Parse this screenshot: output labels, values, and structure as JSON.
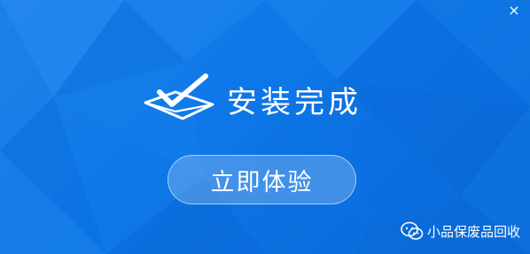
{
  "window": {
    "close_glyph": "×",
    "background_color": "#0f78e8"
  },
  "hero": {
    "icon": "checkmark-envelope-icon",
    "title": "安装完成"
  },
  "cta": {
    "label": "立即体验"
  },
  "watermark": {
    "icon": "wechat-icon",
    "text": "小品保废品回收"
  }
}
